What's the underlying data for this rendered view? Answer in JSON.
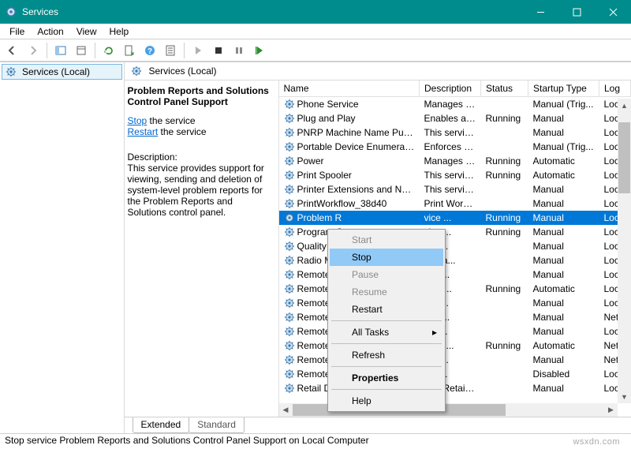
{
  "window": {
    "title": "Services",
    "minimize": "–",
    "maximize": "□",
    "close": "×"
  },
  "menubar": {
    "file": "File",
    "action": "Action",
    "view": "View",
    "help": "Help"
  },
  "nav": {
    "local": "Services (Local)"
  },
  "content": {
    "heading": "Services (Local)",
    "selected_name": "Problem Reports and Solutions Control Panel Support",
    "links": {
      "stop": "Stop",
      "stop_suffix": " the service",
      "restart": "Restart",
      "restart_suffix": " the service"
    },
    "desc_label": "Description:",
    "desc_text": "This service provides support for viewing, sending and deletion of system-level problem reports for the Problem Reports and Solutions control panel."
  },
  "columns": {
    "name": "Name",
    "description": "Description",
    "status": "Status",
    "startup": "Startup Type",
    "logon": "Log"
  },
  "services": [
    {
      "name": "Phone Service",
      "desc": "Manages th...",
      "status": "",
      "startup": "Manual (Trig...",
      "logon": "Loc"
    },
    {
      "name": "Plug and Play",
      "desc": "Enables a c...",
      "status": "Running",
      "startup": "Manual",
      "logon": "Loc"
    },
    {
      "name": "PNRP Machine Name Publi...",
      "desc": "This service ...",
      "status": "",
      "startup": "Manual",
      "logon": "Loc"
    },
    {
      "name": "Portable Device Enumerator...",
      "desc": "Enforces gr...",
      "status": "",
      "startup": "Manual (Trig...",
      "logon": "Loc"
    },
    {
      "name": "Power",
      "desc": "Manages p...",
      "status": "Running",
      "startup": "Automatic",
      "logon": "Loc"
    },
    {
      "name": "Print Spooler",
      "desc": "This service ...",
      "status": "Running",
      "startup": "Automatic",
      "logon": "Loc"
    },
    {
      "name": "Printer Extensions and Notif...",
      "desc": "This service ...",
      "status": "",
      "startup": "Manual",
      "logon": "Loc"
    },
    {
      "name": "PrintWorkflow_38d40",
      "desc": "Print Workfl...",
      "status": "",
      "startup": "Manual",
      "logon": "Loc"
    },
    {
      "name": "Problem R",
      "desc": "vice ...",
      "status": "Running",
      "startup": "Manual",
      "logon": "Loc",
      "selected": true
    },
    {
      "name": "Program C",
      "desc": "vice ...",
      "status": "Running",
      "startup": "Manual",
      "logon": "Loc"
    },
    {
      "name": "Quality Wi",
      "desc": "Win...",
      "status": "",
      "startup": "Manual",
      "logon": "Loc"
    },
    {
      "name": "Radio Man",
      "desc": "Mana...",
      "status": "",
      "startup": "Manual",
      "logon": "Loc"
    },
    {
      "name": "Remote Ac",
      "desc": "a co...",
      "status": "",
      "startup": "Manual",
      "logon": "Loc"
    },
    {
      "name": "Remote Ac",
      "desc": "es di...",
      "status": "Running",
      "startup": "Automatic",
      "logon": "Loc"
    },
    {
      "name": "Remote De",
      "desc": "Des...",
      "status": "",
      "startup": "Manual",
      "logon": "Loc"
    },
    {
      "name": "Remote De",
      "desc": "user...",
      "status": "",
      "startup": "Manual",
      "logon": "Net"
    },
    {
      "name": "Remote De",
      "desc": "he r...",
      "status": "",
      "startup": "Manual",
      "logon": "Loc"
    },
    {
      "name": "Remote Pr",
      "desc": "CSS ...",
      "status": "Running",
      "startup": "Automatic",
      "logon": "Net"
    },
    {
      "name": "Remote Pr",
      "desc": "ows...",
      "status": "",
      "startup": "Manual",
      "logon": "Net"
    },
    {
      "name": "Remote Re",
      "desc": "ote ...",
      "status": "",
      "startup": "Disabled",
      "logon": "Loc"
    },
    {
      "name": "Retail Demo Service",
      "desc": "The Retail D...",
      "status": "",
      "startup": "Manual",
      "logon": "Loc"
    }
  ],
  "context_menu": {
    "start": "Start",
    "stop": "Stop",
    "pause": "Pause",
    "resume": "Resume",
    "restart": "Restart",
    "all_tasks": "All Tasks",
    "refresh": "Refresh",
    "properties": "Properties",
    "help": "Help"
  },
  "tabs": {
    "extended": "Extended",
    "standard": "Standard"
  },
  "statusbar": "Stop service Problem Reports and Solutions Control Panel Support on Local Computer",
  "watermark": "wsxdn.com"
}
